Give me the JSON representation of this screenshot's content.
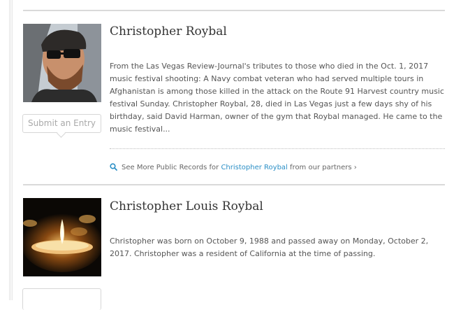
{
  "entries": [
    {
      "name": "Christopher Roybal",
      "photo": "man-with-sunglasses-photo",
      "description": "From the Las Vegas Review-Journal's tributes to those who died in the Oct. 1, 2017 music festival shooting: A Navy combat veteran who had served multiple tours in Afghanistan is among those killed in the attack on the Route 91 Harvest country music festival Sunday. Christopher Roybal, 28, died in Las Vegas just a few days shy of his birthday, said David Harman, owner of the gym that Roybal managed. He came to the music festival...",
      "submit_label": "Submit an Entry",
      "records": {
        "prefix": "See More Public Records for",
        "link": "Christopher Roybal",
        "suffix": "from our partners ›"
      }
    },
    {
      "name": "Christopher Louis Roybal",
      "photo": "candle-photo",
      "description": "Christopher was born on October 9, 1988 and passed away on Monday, October 2, 2017. Christopher was a resident of California at the time of passing."
    }
  ],
  "colors": {
    "link": "#2b8fc6",
    "divider": "#d9d9d9",
    "text": "#555555"
  }
}
